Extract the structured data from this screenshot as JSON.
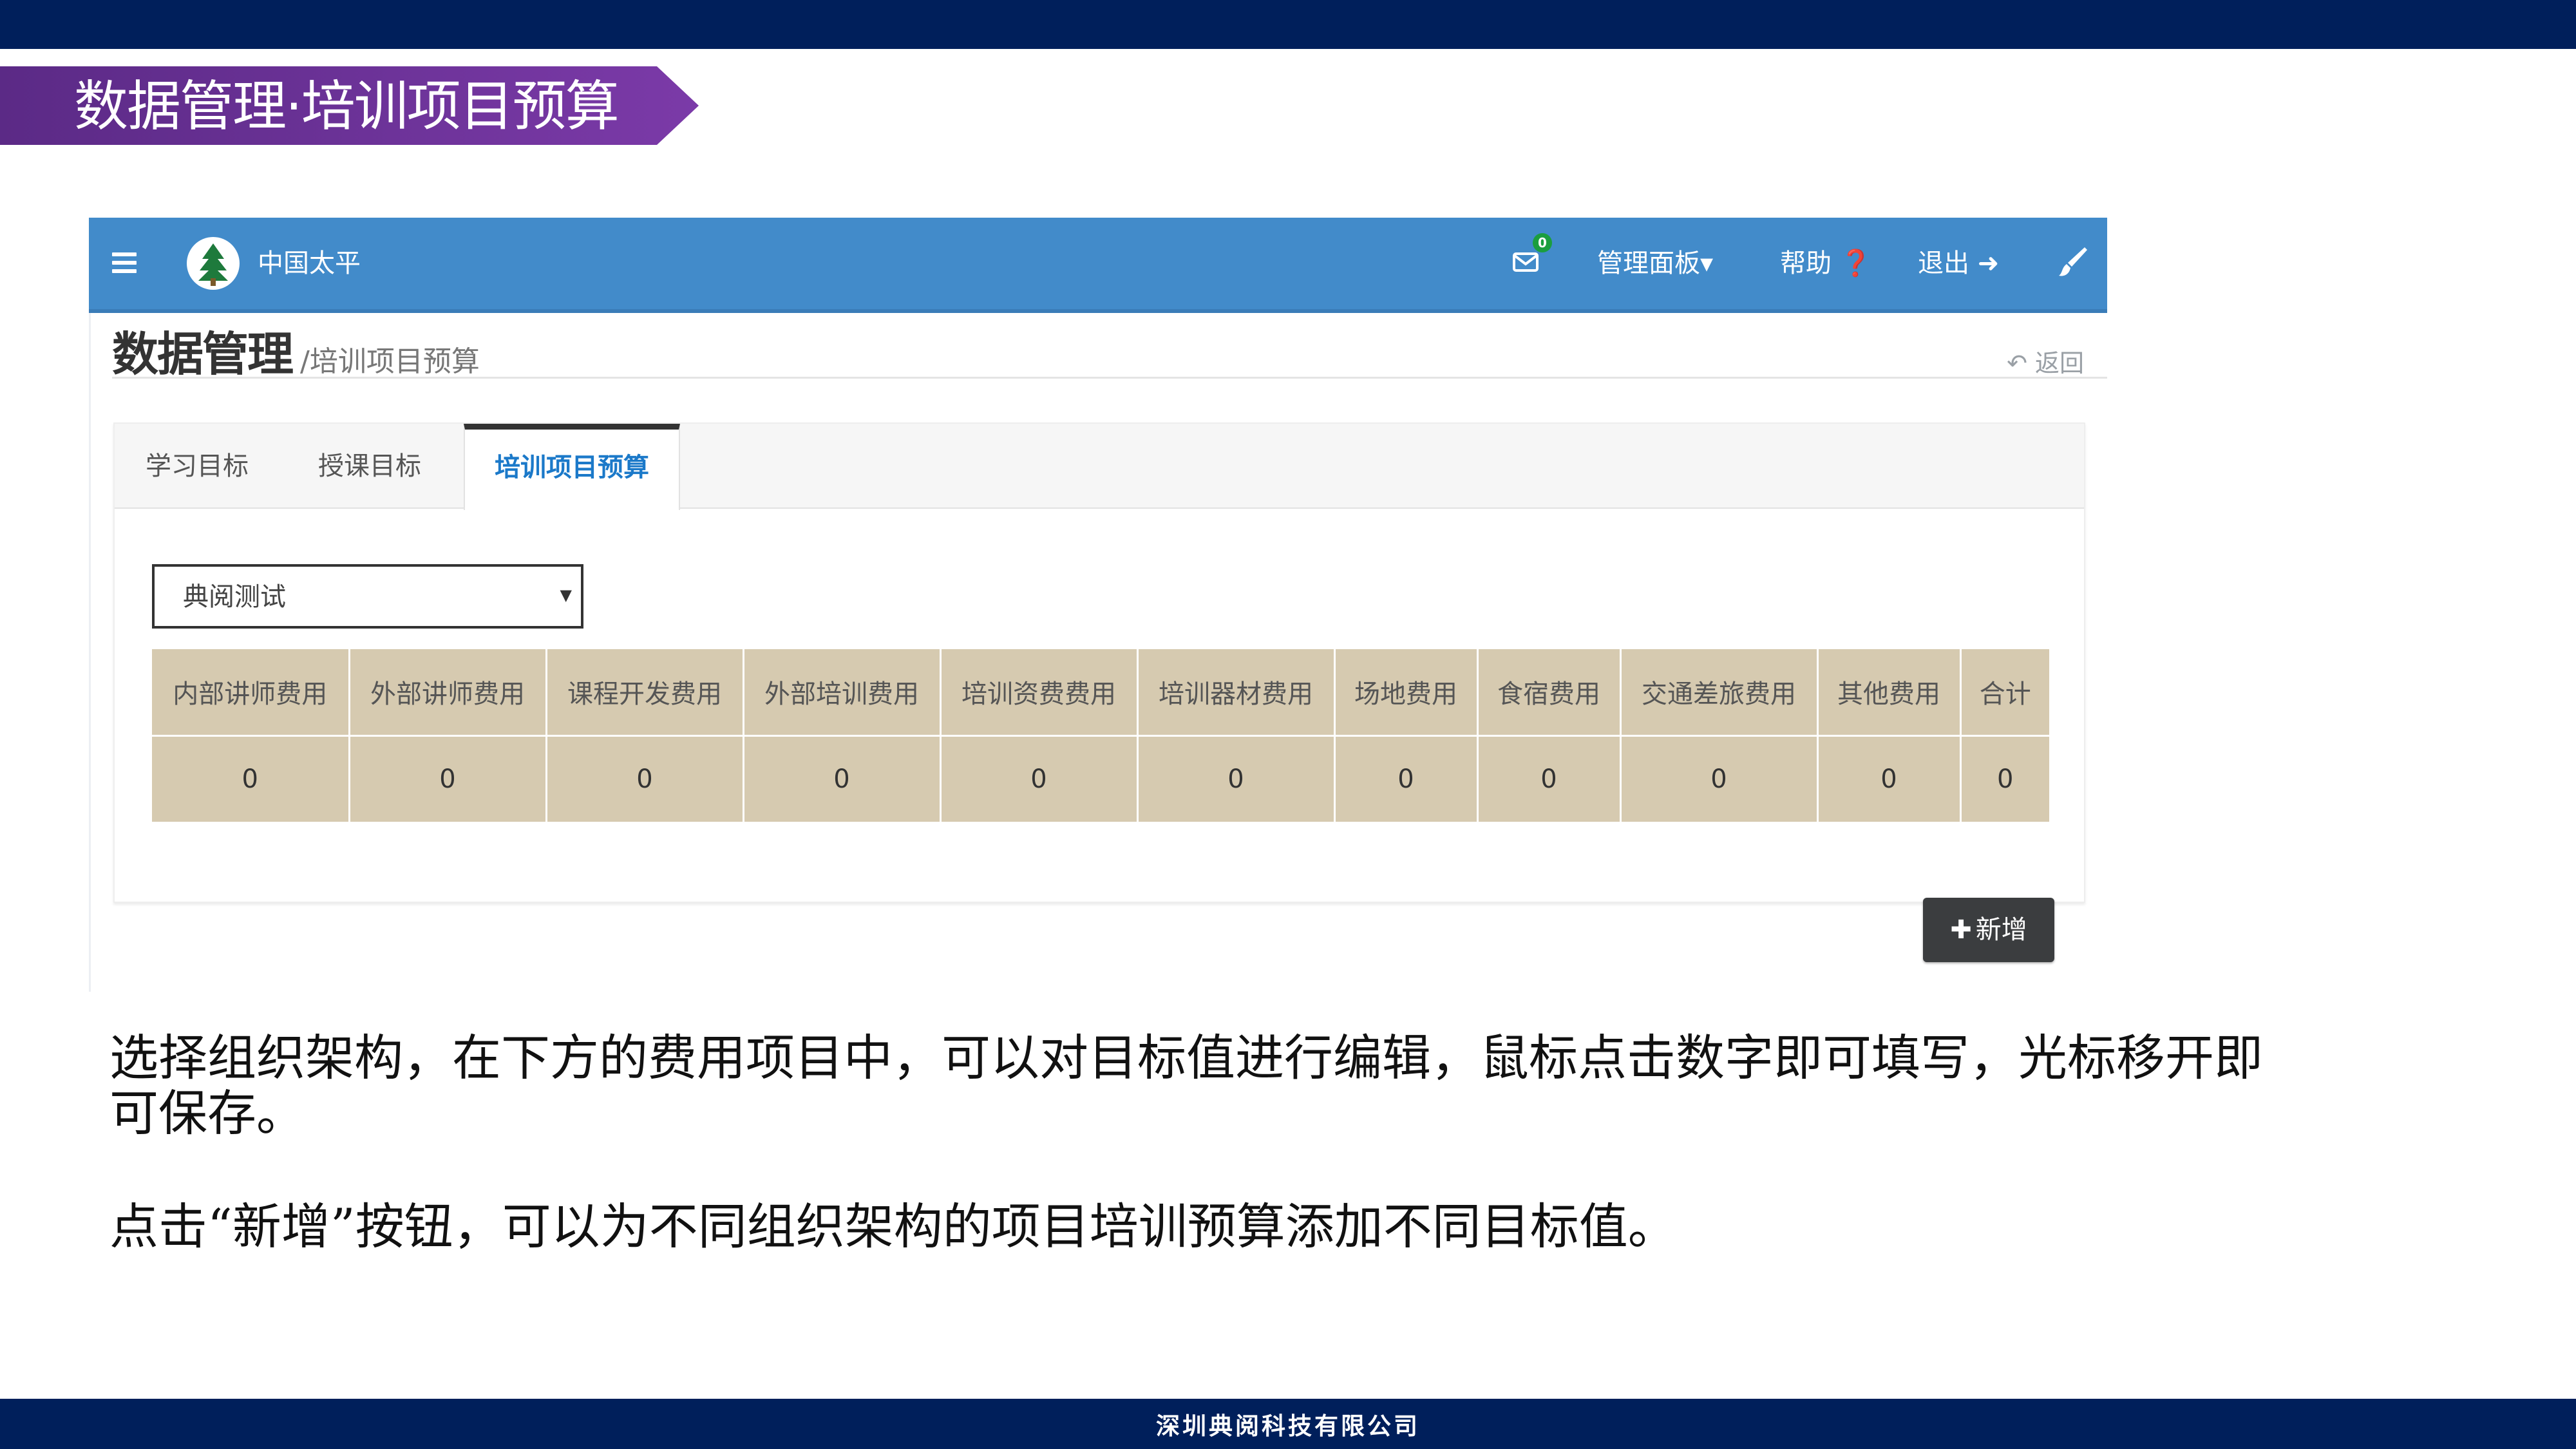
{
  "slide": {
    "title": "数据管理·培训项目预算",
    "footer": "深圳典阅科技有限公司",
    "description_1": "选择组织架构，在下方的费用项目中，可以对目标值进行编辑，鼠标点击数字即可填写，光标移开即可保存。",
    "description_2": "点击“新增”按钮，可以为不同组织架构的项目培训预算添加不同目标值。"
  },
  "app": {
    "brand": "中国太平",
    "mail_badge": "0",
    "nav_manage": "管理面板▾",
    "nav_help": "帮助 ❓",
    "nav_logout": "退出 ➜",
    "page_title": "数据管理",
    "page_subtitle": "/培训项目预算",
    "back_label": "↶ 返回",
    "tabs": [
      "学习目标",
      "授课目标",
      "培训项目预算"
    ],
    "select_value": "典阅测试",
    "table": {
      "headers": [
        "内部讲师费用",
        "外部讲师费用",
        "课程开发费用",
        "外部培训费用",
        "培训资费费用",
        "培训器材费用",
        "场地费用",
        "食宿费用",
        "交通差旅费用",
        "其他费用",
        "合计"
      ],
      "values": [
        "0",
        "0",
        "0",
        "0",
        "0",
        "0",
        "0",
        "0",
        "0",
        "0",
        "0"
      ]
    },
    "add_button": "新增"
  },
  "colors": {
    "slide_bar": "#001f5b",
    "title_banner": "#6a2f9a",
    "navbar": "#428bca",
    "active_tab_text": "#1b79c9",
    "table_bg": "#d6cab0",
    "add_button": "#3b3d3f"
  }
}
